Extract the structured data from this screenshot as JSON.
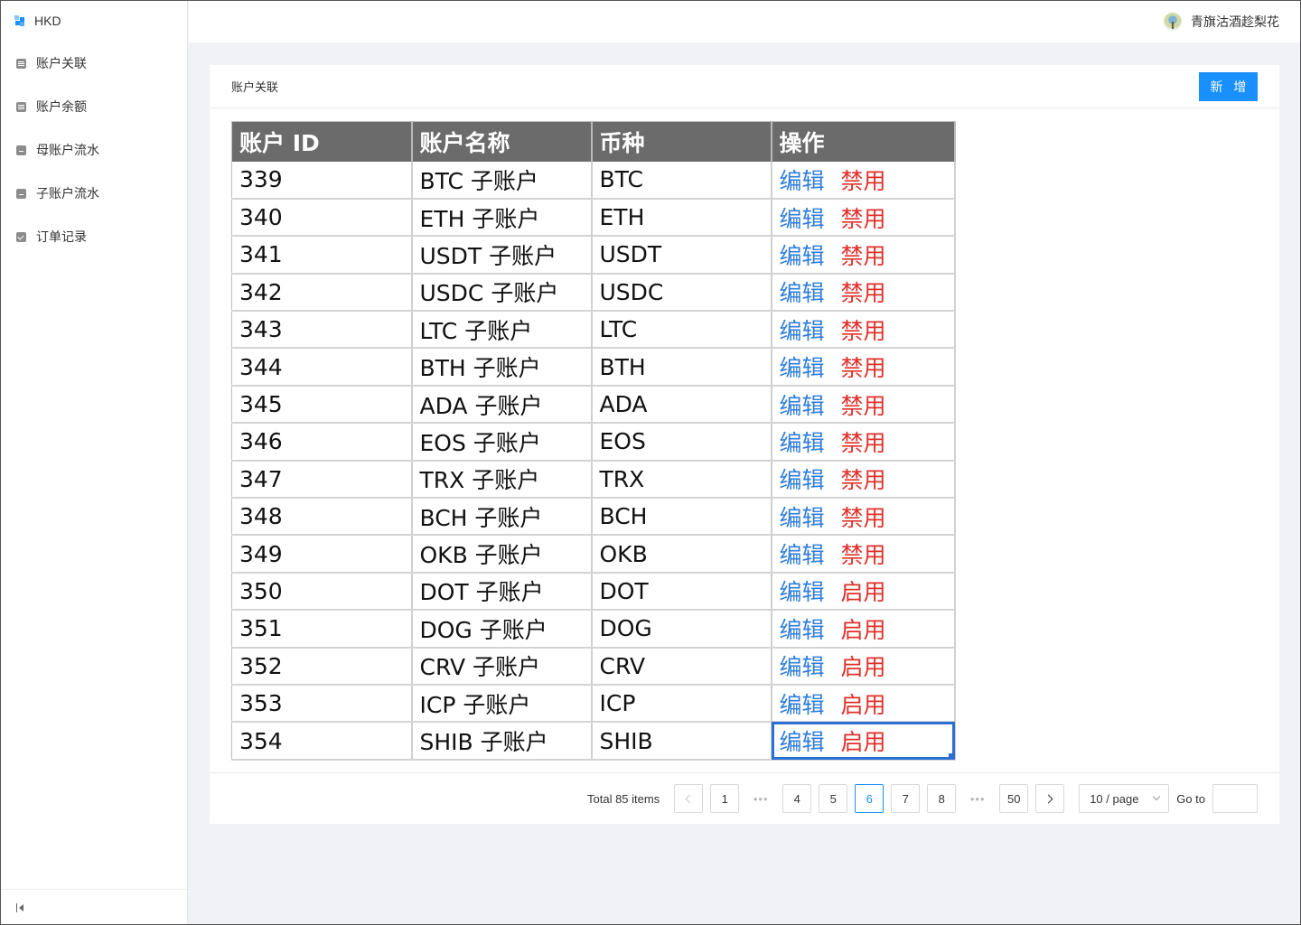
{
  "app": {
    "brand": "HKD"
  },
  "sidebar": {
    "items": [
      {
        "label": "账户关联",
        "icon": "document-icon"
      },
      {
        "label": "账户余额",
        "icon": "document-icon"
      },
      {
        "label": "母账户流水",
        "icon": "bag-icon"
      },
      {
        "label": "子账户流水",
        "icon": "bag-icon"
      },
      {
        "label": "订单记录",
        "icon": "check-square-icon"
      }
    ]
  },
  "header": {
    "username": "青旗沽酒趁梨花"
  },
  "page": {
    "title": "账户关联",
    "add_button": "新 增"
  },
  "table": {
    "columns": [
      "账户 ID",
      "账户名称",
      "币种",
      "操作"
    ],
    "edit_label": "编辑",
    "rows": [
      {
        "id": "339",
        "name": "BTC 子账户",
        "currency": "BTC",
        "toggle": "禁用"
      },
      {
        "id": "340",
        "name": "ETH 子账户",
        "currency": "ETH",
        "toggle": "禁用"
      },
      {
        "id": "341",
        "name": "USDT 子账户",
        "currency": "USDT",
        "toggle": "禁用"
      },
      {
        "id": "342",
        "name": "USDC 子账户",
        "currency": "USDC",
        "toggle": "禁用"
      },
      {
        "id": "343",
        "name": "LTC 子账户",
        "currency": "LTC",
        "toggle": "禁用"
      },
      {
        "id": "344",
        "name": "BTH 子账户",
        "currency": "BTH",
        "toggle": "禁用"
      },
      {
        "id": "345",
        "name": "ADA 子账户",
        "currency": "ADA",
        "toggle": "禁用"
      },
      {
        "id": "346",
        "name": "EOS 子账户",
        "currency": "EOS",
        "toggle": "禁用"
      },
      {
        "id": "347",
        "name": "TRX 子账户",
        "currency": "TRX",
        "toggle": "禁用"
      },
      {
        "id": "348",
        "name": "BCH 子账户",
        "currency": "BCH",
        "toggle": "禁用"
      },
      {
        "id": "349",
        "name": "OKB 子账户",
        "currency": "OKB",
        "toggle": "禁用"
      },
      {
        "id": "350",
        "name": "DOT 子账户",
        "currency": "DOT",
        "toggle": "启用"
      },
      {
        "id": "351",
        "name": "DOG 子账户",
        "currency": "DOG",
        "toggle": "启用"
      },
      {
        "id": "352",
        "name": "CRV 子账户",
        "currency": "CRV",
        "toggle": "启用"
      },
      {
        "id": "353",
        "name": "ICP 子账户",
        "currency": "ICP",
        "toggle": "启用"
      },
      {
        "id": "354",
        "name": "SHIB 子账户",
        "currency": "SHIB",
        "toggle": "启用"
      }
    ]
  },
  "pagination": {
    "total": "Total 85 items",
    "pages": [
      "1",
      "4",
      "5",
      "6",
      "7",
      "8",
      "50"
    ],
    "current": "6",
    "ellipsis": "•••",
    "page_size": "10 / page",
    "goto_label": "Go to"
  },
  "colors": {
    "primary": "#1890ff",
    "edit": "#2f7ddb",
    "toggle": "#e0302b",
    "table_header": "#6b6b6b"
  }
}
